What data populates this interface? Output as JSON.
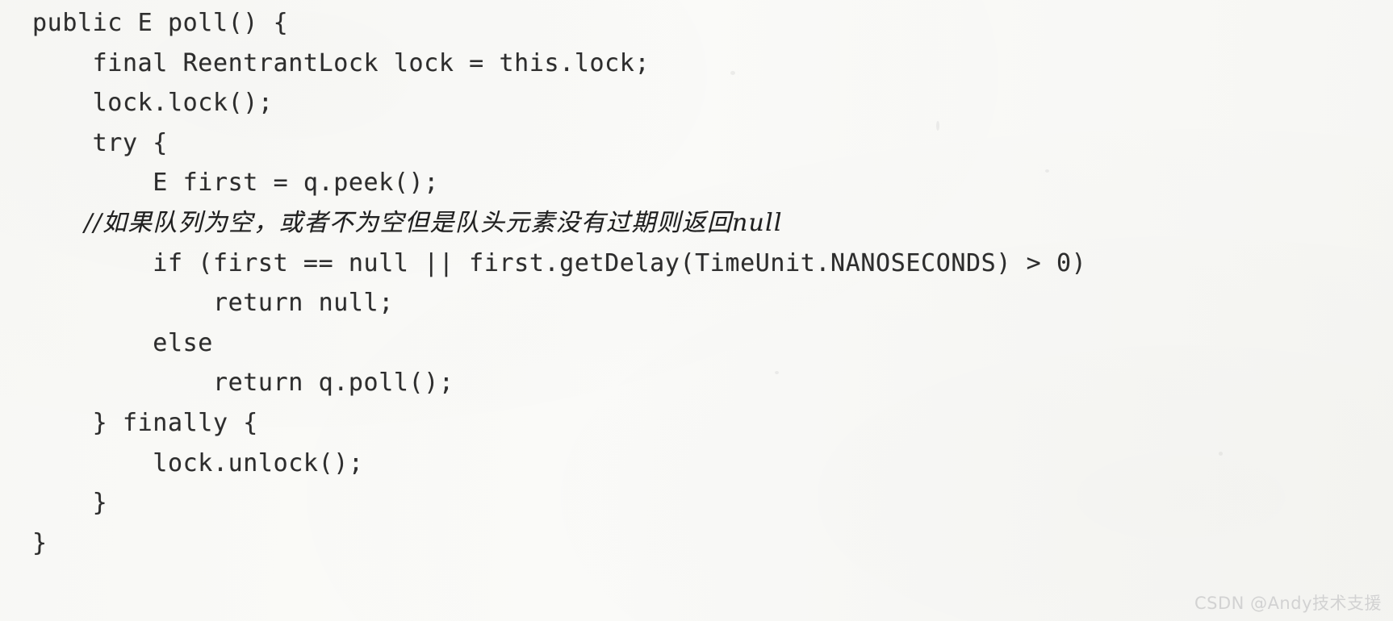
{
  "page": {
    "kind": "scanned-book-page",
    "background_color": "#fdfdfc",
    "text_color": "#2d2d2d",
    "watermark_color": "#d2d2d2"
  },
  "code": {
    "language": "Java",
    "lines": [
      "public E poll() {",
      "    final ReentrantLock lock = this.lock;",
      "    lock.lock();",
      "    try {",
      "        E first = q.peek();",
      "      //如果队列为空，或者不为空但是队头元素没有过期则返回null",
      "        if (first == null || first.getDelay(TimeUnit.NANOSECONDS) > 0)",
      "            return null;",
      "        else",
      "            return q.poll();",
      "    } finally {",
      "        lock.unlock();",
      "    }",
      "}"
    ],
    "comment_line_index": 5
  },
  "watermark": {
    "text": "CSDN @Andy技术支援"
  }
}
